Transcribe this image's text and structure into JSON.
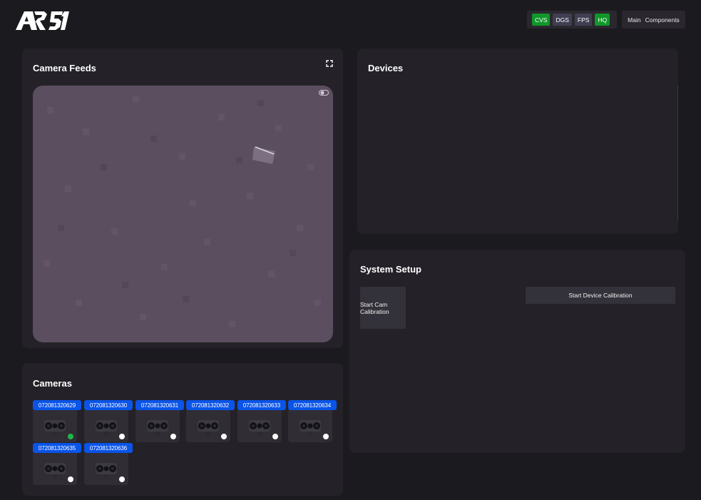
{
  "header": {
    "logo_text": "AR 51",
    "toggles": [
      {
        "label": "CVS",
        "state": "on"
      },
      {
        "label": "DGS",
        "state": "off"
      },
      {
        "label": "FPS",
        "state": "off"
      },
      {
        "label": "HQ",
        "state": "on"
      }
    ],
    "nav": {
      "main": "Main",
      "components": "Components"
    }
  },
  "camera_feeds": {
    "title": "Camera Feeds",
    "expand_icon": "expand-icon",
    "view_toggle_icon": "toggle-icon"
  },
  "devices": {
    "title": "Devices"
  },
  "system_setup": {
    "title": "System Setup",
    "cam_calibration_label": "Start Cam Calibration",
    "device_calibration_label": "Start Device Calibration"
  },
  "cameras": {
    "title": "Cameras",
    "items": [
      {
        "id": "072081320629",
        "status": "ok"
      },
      {
        "id": "072081320630",
        "status": "idle"
      },
      {
        "id": "072081320631",
        "status": "idle"
      },
      {
        "id": "072081320632",
        "status": "idle"
      },
      {
        "id": "072081320633",
        "status": "idle"
      },
      {
        "id": "072081320634",
        "status": "idle"
      },
      {
        "id": "072081320635",
        "status": "idle"
      },
      {
        "id": "072081320636",
        "status": "idle"
      }
    ]
  },
  "colors": {
    "background": "#1b1a1e",
    "panel": "#242228",
    "toggle_on": "#109629",
    "toggle_off": "#403f52",
    "camera_label": "#0a54e8",
    "status_ok": "#1fb84a",
    "status_idle": "#ffffff"
  }
}
